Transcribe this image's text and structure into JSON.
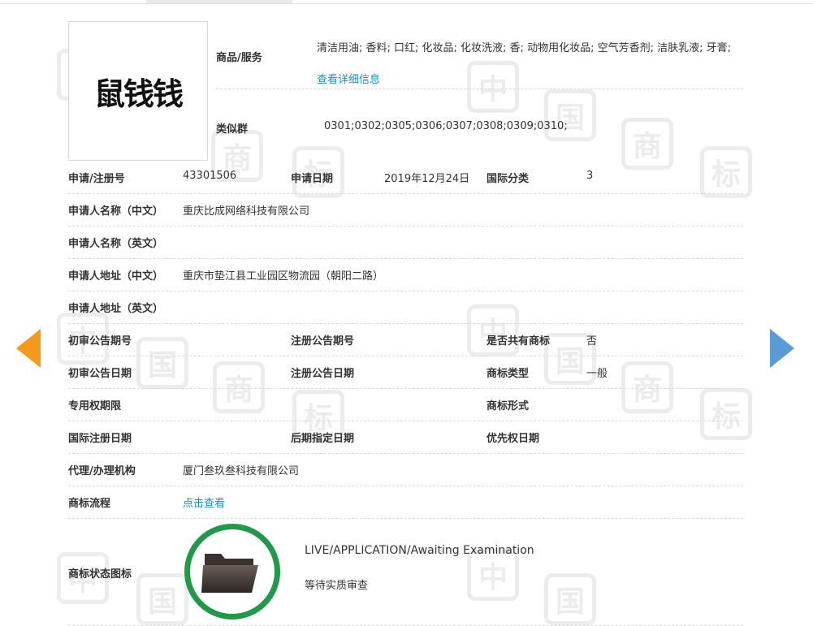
{
  "header": {
    "tab_label": ""
  },
  "logo": {
    "mark_text": "鼠钱钱"
  },
  "goods": {
    "label": "商品/服务",
    "text": "清洁用油; 香料; 口红; 化妆品; 化妆洗液; 香; 动物用化妆品; 空气芳香剂; 洁肤乳液; 牙膏;",
    "detail_link": "查看详细信息"
  },
  "similar": {
    "label": "类似群",
    "value": "0301;0302;0305;0306;0307;0308;0309;0310;"
  },
  "rows": {
    "reg_no_label": "申请/注册号",
    "reg_no": "43301506",
    "app_date_label": "申请日期",
    "app_date": "2019年12月24日",
    "intl_class_label": "国际分类",
    "intl_class": "3",
    "applicant_cn_label": "申请人名称（中文）",
    "applicant_cn": "重庆比成网络科技有限公司",
    "applicant_en_label": "申请人名称（英文）",
    "applicant_en": "",
    "address_cn_label": "申请人地址（中文）",
    "address_cn": "重庆市垫江县工业园区物流园（朝阳二路）",
    "address_en_label": "申请人地址（英文）",
    "address_en": "",
    "prelim_pub_no_label": "初审公告期号",
    "prelim_pub_no": "",
    "reg_pub_no_label": "注册公告期号",
    "reg_pub_no": "",
    "shared_label": "是否共有商标",
    "shared": "否",
    "prelim_pub_date_label": "初审公告日期",
    "prelim_pub_date": "",
    "reg_pub_date_label": "注册公告日期",
    "reg_pub_date": "",
    "tm_type_label": "商标类型",
    "tm_type": "一般",
    "exclusive_label": "专用权期限",
    "exclusive": "",
    "tm_form_label": "商标形式",
    "tm_form": "",
    "intl_reg_date_label": "国际注册日期",
    "intl_reg_date": "",
    "later_date_label": "后期指定日期",
    "later_date": "",
    "priority_label": "优先权日期",
    "priority": "",
    "agent_label": "代理/办理机构",
    "agent": "厦门叁玖叁科技有限公司",
    "flow_label": "商标流程",
    "flow_link": "点击查看"
  },
  "status": {
    "label": "商标状态图标",
    "en": "LIVE/APPLICATION/Awaiting Examination",
    "cn": "等待实质审查"
  },
  "watermark": {
    "char_a": "中",
    "char_b": "国",
    "char_c": "商",
    "char_d": "标"
  },
  "colors": {
    "accent_link": "#1a8fc4",
    "status_ring": "#1e9a49",
    "arrow_left": "#f39a1d",
    "arrow_right": "#5b9bd5"
  }
}
